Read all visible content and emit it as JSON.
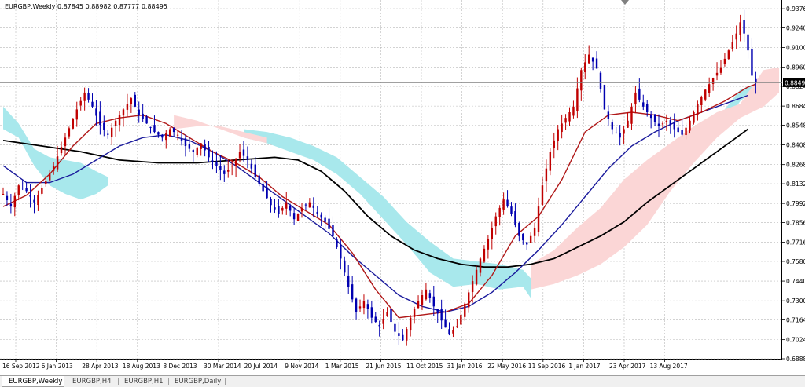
{
  "chart": {
    "title": "EURGBP,Weekly  0.87845 0.88982 0.87777 0.88495"
  },
  "tabs": [
    {
      "label": "EURGBP,Weekly",
      "active": true
    },
    {
      "label": "EURGBP,H4",
      "active": false
    },
    {
      "label": "EURGBP,H1",
      "active": false
    },
    {
      "label": "EURGBP,Daily",
      "active": false
    }
  ],
  "chart_data": {
    "type": "candlestick",
    "symbol": "EURGBP",
    "timeframe": "Weekly",
    "ohlc_last": {
      "open": 0.87845,
      "high": 0.88982,
      "low": 0.87777,
      "close": 0.88495
    },
    "current_price": 0.88495,
    "price_label": "0.88495",
    "ylim": [
      0.6888,
      0.9438
    ],
    "y_ticks": [
      "0.93760",
      "0.92400",
      "0.91000",
      "0.89600",
      "0.88240",
      "0.86840",
      "0.85480",
      "0.84080",
      "0.82680",
      "0.81320",
      "0.79920",
      "0.78560",
      "0.77160",
      "0.75800",
      "0.74400",
      "0.73000",
      "0.71640",
      "0.70240",
      "0.68880"
    ],
    "x_ticks": [
      "16 Sep 2012",
      "6 Jan 2013",
      "28 Apr 2013",
      "18 Aug 2013",
      "8 Dec 2013",
      "30 Mar 2014",
      "20 Jul 2014",
      "9 Nov 2014",
      "1 Mar 2015",
      "21 Jun 2015",
      "11 Oct 2015",
      "31 Jan 2016",
      "22 May 2016",
      "11 Sep 2016",
      "1 Jan 2017",
      "23 Apr 2017",
      "13 Aug 2017"
    ],
    "grid": true,
    "price_path": [
      [
        0,
        0.806
      ],
      [
        2,
        0.797
      ],
      [
        4,
        0.812
      ],
      [
        6,
        0.808
      ],
      [
        8,
        0.8
      ],
      [
        10,
        0.81
      ],
      [
        13,
        0.826
      ],
      [
        16,
        0.846
      ],
      [
        19,
        0.866
      ],
      [
        21,
        0.878
      ],
      [
        23,
        0.868
      ],
      [
        25,
        0.855
      ],
      [
        27,
        0.848
      ],
      [
        29,
        0.858
      ],
      [
        31,
        0.866
      ],
      [
        33,
        0.874
      ],
      [
        35,
        0.862
      ],
      [
        37,
        0.856
      ],
      [
        39,
        0.85
      ],
      [
        41,
        0.846
      ],
      [
        43,
        0.852
      ],
      [
        45,
        0.848
      ],
      [
        47,
        0.84
      ],
      [
        49,
        0.836
      ],
      [
        51,
        0.842
      ],
      [
        53,
        0.832
      ],
      [
        55,
        0.826
      ],
      [
        57,
        0.82
      ],
      [
        59,
        0.826
      ],
      [
        61,
        0.836
      ],
      [
        63,
        0.83
      ],
      [
        65,
        0.818
      ],
      [
        67,
        0.808
      ],
      [
        69,
        0.798
      ],
      [
        71,
        0.792
      ],
      [
        73,
        0.8
      ],
      [
        75,
        0.788
      ],
      [
        77,
        0.796
      ],
      [
        79,
        0.8
      ],
      [
        81,
        0.792
      ],
      [
        83,
        0.786
      ],
      [
        85,
        0.776
      ],
      [
        87,
        0.76
      ],
      [
        89,
        0.74
      ],
      [
        91,
        0.722
      ],
      [
        93,
        0.73
      ],
      [
        95,
        0.718
      ],
      [
        97,
        0.712
      ],
      [
        99,
        0.722
      ],
      [
        101,
        0.708
      ],
      [
        103,
        0.702
      ],
      [
        105,
        0.718
      ],
      [
        107,
        0.73
      ],
      [
        109,
        0.738
      ],
      [
        111,
        0.726
      ],
      [
        113,
        0.716
      ],
      [
        115,
        0.706
      ],
      [
        117,
        0.712
      ],
      [
        119,
        0.728
      ],
      [
        121,
        0.744
      ],
      [
        123,
        0.76
      ],
      [
        125,
        0.774
      ],
      [
        127,
        0.79
      ],
      [
        129,
        0.802
      ],
      [
        131,
        0.792
      ],
      [
        133,
        0.776
      ],
      [
        135,
        0.77
      ],
      [
        137,
        0.782
      ],
      [
        139,
        0.812
      ],
      [
        141,
        0.836
      ],
      [
        143,
        0.852
      ],
      [
        145,
        0.86
      ],
      [
        147,
        0.868
      ],
      [
        149,
        0.894
      ],
      [
        151,
        0.905
      ],
      [
        153,
        0.895
      ],
      [
        155,
        0.866
      ],
      [
        157,
        0.852
      ],
      [
        159,
        0.846
      ],
      [
        161,
        0.858
      ],
      [
        163,
        0.878
      ],
      [
        165,
        0.868
      ],
      [
        167,
        0.86
      ],
      [
        169,
        0.854
      ],
      [
        171,
        0.858
      ],
      [
        173,
        0.852
      ],
      [
        175,
        0.848
      ],
      [
        177,
        0.858
      ],
      [
        179,
        0.87
      ],
      [
        181,
        0.88
      ],
      [
        183,
        0.888
      ],
      [
        185,
        0.896
      ],
      [
        187,
        0.908
      ],
      [
        189,
        0.92
      ],
      [
        190,
        0.928
      ],
      [
        191,
        0.92
      ],
      [
        192,
        0.908
      ],
      [
        193,
        0.89
      ],
      [
        194,
        0.885
      ]
    ],
    "ma_fast": [
      [
        0,
        0.797
      ],
      [
        6,
        0.805
      ],
      [
        12,
        0.82
      ],
      [
        18,
        0.84
      ],
      [
        24,
        0.856
      ],
      [
        30,
        0.86
      ],
      [
        36,
        0.862
      ],
      [
        42,
        0.856
      ],
      [
        48,
        0.846
      ],
      [
        54,
        0.836
      ],
      [
        60,
        0.828
      ],
      [
        66,
        0.818
      ],
      [
        72,
        0.804
      ],
      [
        78,
        0.794
      ],
      [
        84,
        0.784
      ],
      [
        90,
        0.764
      ],
      [
        96,
        0.738
      ],
      [
        102,
        0.718
      ],
      [
        108,
        0.72
      ],
      [
        114,
        0.722
      ],
      [
        120,
        0.728
      ],
      [
        126,
        0.748
      ],
      [
        132,
        0.776
      ],
      [
        138,
        0.79
      ],
      [
        144,
        0.816
      ],
      [
        150,
        0.85
      ],
      [
        156,
        0.862
      ],
      [
        162,
        0.864
      ],
      [
        168,
        0.862
      ],
      [
        174,
        0.858
      ],
      [
        180,
        0.864
      ],
      [
        186,
        0.872
      ],
      [
        192,
        0.882
      ],
      [
        194,
        0.884
      ]
    ],
    "ma_mid": [
      [
        0,
        0.826
      ],
      [
        6,
        0.814
      ],
      [
        12,
        0.814
      ],
      [
        18,
        0.82
      ],
      [
        24,
        0.83
      ],
      [
        30,
        0.84
      ],
      [
        36,
        0.846
      ],
      [
        42,
        0.848
      ],
      [
        48,
        0.844
      ],
      [
        54,
        0.836
      ],
      [
        60,
        0.826
      ],
      [
        66,
        0.814
      ],
      [
        72,
        0.802
      ],
      [
        78,
        0.79
      ],
      [
        84,
        0.778
      ],
      [
        90,
        0.762
      ],
      [
        96,
        0.748
      ],
      [
        102,
        0.734
      ],
      [
        108,
        0.726
      ],
      [
        114,
        0.722
      ],
      [
        120,
        0.726
      ],
      [
        126,
        0.736
      ],
      [
        132,
        0.75
      ],
      [
        138,
        0.766
      ],
      [
        144,
        0.784
      ],
      [
        150,
        0.804
      ],
      [
        156,
        0.824
      ],
      [
        162,
        0.84
      ],
      [
        168,
        0.85
      ],
      [
        174,
        0.858
      ],
      [
        180,
        0.864
      ],
      [
        186,
        0.87
      ],
      [
        192,
        0.876
      ]
    ],
    "ma_slow": [
      [
        0,
        0.844
      ],
      [
        10,
        0.84
      ],
      [
        20,
        0.836
      ],
      [
        30,
        0.83
      ],
      [
        40,
        0.828
      ],
      [
        50,
        0.828
      ],
      [
        60,
        0.83
      ],
      [
        70,
        0.832
      ],
      [
        76,
        0.83
      ],
      [
        82,
        0.822
      ],
      [
        88,
        0.808
      ],
      [
        94,
        0.79
      ],
      [
        100,
        0.776
      ],
      [
        106,
        0.766
      ],
      [
        112,
        0.76
      ],
      [
        118,
        0.756
      ],
      [
        124,
        0.754
      ],
      [
        130,
        0.754
      ],
      [
        136,
        0.756
      ],
      [
        142,
        0.76
      ],
      [
        148,
        0.768
      ],
      [
        154,
        0.776
      ],
      [
        160,
        0.786
      ],
      [
        166,
        0.8
      ],
      [
        172,
        0.812
      ],
      [
        178,
        0.824
      ],
      [
        184,
        0.836
      ],
      [
        190,
        0.848
      ],
      [
        192,
        0.852
      ]
    ],
    "cloud_bull": [
      [
        [
          0,
          0.852
        ],
        [
          4,
          0.846
        ],
        [
          8,
          0.826
        ],
        [
          12,
          0.812
        ],
        [
          16,
          0.806
        ],
        [
          20,
          0.802
        ],
        [
          24,
          0.806
        ],
        [
          27,
          0.812
        ]
      ],
      [
        [
          27,
          0.818
        ],
        [
          24,
          0.822
        ],
        [
          20,
          0.828
        ],
        [
          16,
          0.83
        ],
        [
          12,
          0.832
        ],
        [
          8,
          0.838
        ],
        [
          4,
          0.856
        ],
        [
          0,
          0.868
        ]
      ]
    ],
    "cloud_bull_2": [
      [
        [
          62,
          0.846
        ],
        [
          68,
          0.842
        ],
        [
          74,
          0.836
        ],
        [
          80,
          0.83
        ],
        [
          86,
          0.82
        ],
        [
          92,
          0.806
        ],
        [
          98,
          0.788
        ],
        [
          104,
          0.77
        ],
        [
          110,
          0.75
        ],
        [
          116,
          0.74
        ],
        [
          122,
          0.742
        ],
        [
          128,
          0.738
        ],
        [
          134,
          0.74
        ],
        [
          136,
          0.732
        ]
      ],
      [
        [
          136,
          0.746
        ],
        [
          134,
          0.752
        ],
        [
          128,
          0.756
        ],
        [
          122,
          0.758
        ],
        [
          116,
          0.76
        ],
        [
          110,
          0.772
        ],
        [
          104,
          0.786
        ],
        [
          98,
          0.804
        ],
        [
          92,
          0.818
        ],
        [
          86,
          0.832
        ],
        [
          80,
          0.84
        ],
        [
          74,
          0.846
        ],
        [
          68,
          0.85
        ],
        [
          62,
          0.852
        ]
      ]
    ],
    "cloud_bear": [
      [
        [
          44,
          0.862
        ],
        [
          50,
          0.858
        ],
        [
          56,
          0.852
        ],
        [
          62,
          0.846
        ],
        [
          68,
          0.842
        ]
      ],
      [
        [
          68,
          0.846
        ],
        [
          62,
          0.85
        ],
        [
          56,
          0.854
        ],
        [
          50,
          0.854
        ],
        [
          44,
          0.852
        ]
      ]
    ],
    "cloud_bear_2": [
      [
        [
          136,
          0.738
        ],
        [
          142,
          0.742
        ],
        [
          148,
          0.748
        ],
        [
          154,
          0.756
        ],
        [
          160,
          0.768
        ],
        [
          166,
          0.784
        ],
        [
          172,
          0.808
        ],
        [
          178,
          0.828
        ],
        [
          184,
          0.846
        ],
        [
          190,
          0.86
        ],
        [
          196,
          0.868
        ],
        [
          200,
          0.878
        ]
      ],
      [
        [
          200,
          0.896
        ],
        [
          196,
          0.894
        ],
        [
          190,
          0.87
        ],
        [
          184,
          0.864
        ],
        [
          178,
          0.854
        ],
        [
          172,
          0.842
        ],
        [
          166,
          0.83
        ],
        [
          160,
          0.816
        ],
        [
          154,
          0.796
        ],
        [
          148,
          0.782
        ],
        [
          142,
          0.766
        ],
        [
          136,
          0.756
        ]
      ]
    ],
    "cloud_bull_3": [
      [
        [
          186,
          0.856
        ],
        [
          190,
          0.872
        ],
        [
          194,
          0.88
        ],
        [
          198,
          0.884
        ]
      ],
      [
        [
          198,
          0.886
        ],
        [
          194,
          0.884
        ],
        [
          190,
          0.88
        ],
        [
          186,
          0.866
        ]
      ]
    ]
  }
}
